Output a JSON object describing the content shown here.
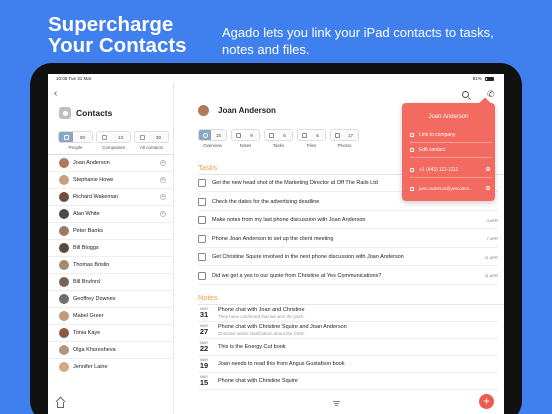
{
  "promo": {
    "headline_line1": "Supercharge",
    "headline_line2": "Your Contacts",
    "tagline": "Agado lets you link your iPad contacts to tasks, notes and files."
  },
  "statusbar": {
    "time": "10:05  Tue 31 Mar",
    "battery": "81%"
  },
  "sidebar": {
    "title": "Contacts",
    "categories": [
      {
        "label": "People",
        "count": "50"
      },
      {
        "label": "Companies",
        "count": "13"
      },
      {
        "label": "All contacts",
        "count": "30"
      }
    ],
    "people": [
      {
        "name": "Joan Anderson",
        "color": "#b07a5c"
      },
      {
        "name": "Stephanie Howe",
        "color": "#c9a07e"
      },
      {
        "name": "Richard Wakeman",
        "color": "#6d5040"
      },
      {
        "name": "Alan White",
        "color": "#4a4a4a"
      },
      {
        "name": "Peter Banks",
        "color": "#9c7a63"
      },
      {
        "name": "Bill Bloggs",
        "color": "#5c4a3e"
      },
      {
        "name": "Thomas Brislin",
        "color": "#a58a70"
      },
      {
        "name": "Bill Bruford",
        "color": "#7a6050"
      },
      {
        "name": "Geoffrey Downes",
        "color": "#6e6e6e"
      },
      {
        "name": "Mabel Greer",
        "color": "#c49a7a"
      },
      {
        "name": "Tonia Kaye",
        "color": "#8a5a40"
      },
      {
        "name": "Olga Khoresheva",
        "color": "#b59580"
      },
      {
        "name": "Jennifer Laine",
        "color": "#d1aa88"
      }
    ]
  },
  "contact": {
    "name": "Joan Anderson",
    "tabs": [
      {
        "label": "Overview",
        "count": "15"
      },
      {
        "label": "Notes",
        "count": "9"
      },
      {
        "label": "Tasks",
        "count": "6"
      },
      {
        "label": "Files",
        "count": "5"
      },
      {
        "label": "Photos",
        "count": "17"
      }
    ]
  },
  "tasks": {
    "title": "Tasks",
    "items": [
      {
        "text": "Get the new head shot of the Marketing Director at Off The Rails Ltd",
        "date": ""
      },
      {
        "text": "Check the dates for the advertising deadline",
        "date": ""
      },
      {
        "text": "Make notes from my last phone discussion with Joan Anderson",
        "date": "3 APR"
      },
      {
        "text": "Phone Joan Anderson to set up the client meeting",
        "date": "7 APR"
      },
      {
        "text": "Get Christine Squire involved in the next phone discussion with Joan Anderson",
        "date": "11 APR"
      },
      {
        "text": "Did we get a yes to our quote from Christine at Yes Communications?",
        "date": "11 APR"
      }
    ]
  },
  "notes": {
    "title": "Notes",
    "items": [
      {
        "month": "MAR",
        "day": "31",
        "title": "Phone chat with Joan and Christine",
        "sub": "They have confirmed that we won the pitch."
      },
      {
        "month": "MAR",
        "day": "27",
        "title": "Phone chat with Christine Squire and Joan Anderson",
        "sub": "Christine wants clarification about the CMS."
      },
      {
        "month": "MAR",
        "day": "22",
        "title": "This is the Energy Cut book",
        "sub": ""
      },
      {
        "month": "MAR",
        "day": "19",
        "title": "Joan needs to read this from Angus Gustafson book",
        "sub": ""
      },
      {
        "month": "MAR",
        "day": "15",
        "title": "Phone chat with Christine Squire",
        "sub": ""
      }
    ]
  },
  "popover": {
    "title": "Joan Anderson",
    "link_company": "Link to company",
    "edit_contact": "Edit contact",
    "phone": "+1 (443) 111-1111",
    "email": "joan.anderson@yescomm..."
  },
  "fab_label": "+"
}
